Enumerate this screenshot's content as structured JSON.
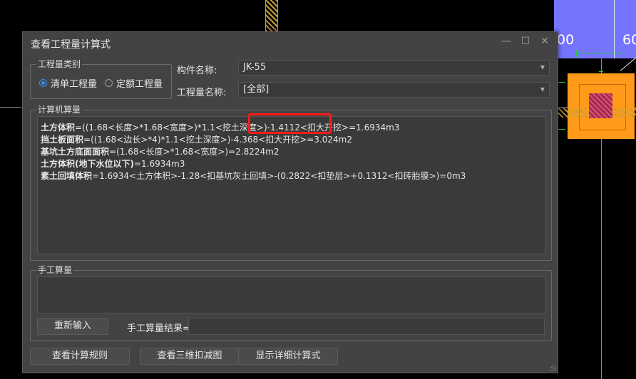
{
  "cad": {
    "tick_left": "00",
    "tick_right": "60",
    "colors": {
      "blue": "#7474ff",
      "orange": "#ff9a1a",
      "green": "#2ecc40",
      "hatch": "#c8a038"
    }
  },
  "dialog": {
    "title": "查看工程量计算式",
    "window_buttons": {
      "minimize": "—",
      "maximize": "☐",
      "close": "✕"
    },
    "quantity_type": {
      "group_title": "工程量类别",
      "options": [
        {
          "label": "清单工程量",
          "checked": true
        },
        {
          "label": "定额工程量",
          "checked": false
        }
      ]
    },
    "component_name": {
      "label": "构件名称:",
      "value": "JK-55"
    },
    "quantity_name": {
      "label": "工程量名称:",
      "value": "[全部]"
    },
    "calc": {
      "group_title": "计算机算量",
      "lines": [
        {
          "name": "土方体积",
          "formula": "=((1.68<长度>*1.68<宽度>)*1.1<挖土深度>)-1.4112<扣大开挖>=1.6934m3"
        },
        {
          "name": "挡土板面积",
          "formula": "=((1.68<边长>*4)*1.1<挖土深度>)-4.368<扣大开挖>=3.024m2"
        },
        {
          "name": "基坑土方底面面积",
          "formula": "=(1.68<长度>*1.68<宽度>)=2.8224m2"
        },
        {
          "name": "土方体积(地下水位以下)",
          "formula": "=1.6934m3"
        },
        {
          "name": "素土回填体积",
          "formula": "=1.6934<土方体积>-1.28<扣基坑灰土回填>-(0.2822<扣垫层>+0.1312<扣砖胎膜>)=0m3"
        }
      ]
    },
    "manual": {
      "group_title": "手工算量",
      "reenter_button": "重新输入",
      "result_label": "手工算量结果=",
      "result_value": ""
    },
    "buttons": {
      "rules": "查看计算规则",
      "view3d": "查看三维扣减图",
      "details": "显示详细计算式"
    },
    "highlight_color": "#ff1a1a"
  }
}
